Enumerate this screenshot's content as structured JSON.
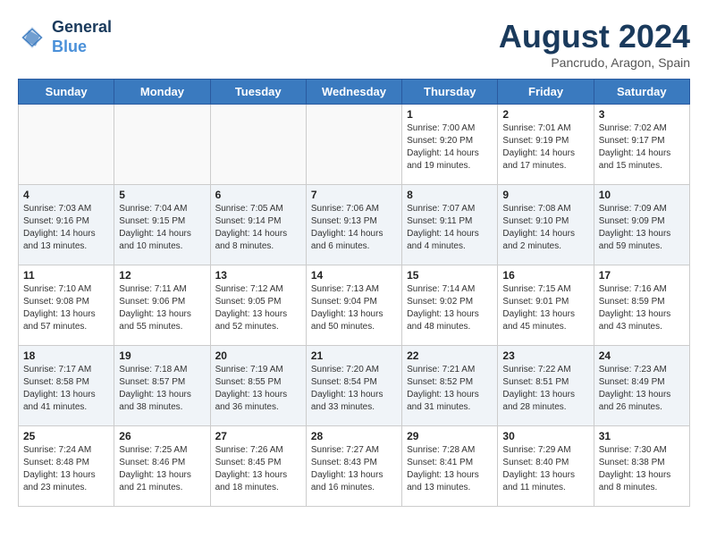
{
  "header": {
    "logo_line1": "General",
    "logo_line2": "Blue",
    "month_title": "August 2024",
    "subtitle": "Pancrudo, Aragon, Spain"
  },
  "days_of_week": [
    "Sunday",
    "Monday",
    "Tuesday",
    "Wednesday",
    "Thursday",
    "Friday",
    "Saturday"
  ],
  "weeks": [
    [
      {
        "day": "",
        "info": ""
      },
      {
        "day": "",
        "info": ""
      },
      {
        "day": "",
        "info": ""
      },
      {
        "day": "",
        "info": ""
      },
      {
        "day": "1",
        "info": "Sunrise: 7:00 AM\nSunset: 9:20 PM\nDaylight: 14 hours\nand 19 minutes."
      },
      {
        "day": "2",
        "info": "Sunrise: 7:01 AM\nSunset: 9:19 PM\nDaylight: 14 hours\nand 17 minutes."
      },
      {
        "day": "3",
        "info": "Sunrise: 7:02 AM\nSunset: 9:17 PM\nDaylight: 14 hours\nand 15 minutes."
      }
    ],
    [
      {
        "day": "4",
        "info": "Sunrise: 7:03 AM\nSunset: 9:16 PM\nDaylight: 14 hours\nand 13 minutes."
      },
      {
        "day": "5",
        "info": "Sunrise: 7:04 AM\nSunset: 9:15 PM\nDaylight: 14 hours\nand 10 minutes."
      },
      {
        "day": "6",
        "info": "Sunrise: 7:05 AM\nSunset: 9:14 PM\nDaylight: 14 hours\nand 8 minutes."
      },
      {
        "day": "7",
        "info": "Sunrise: 7:06 AM\nSunset: 9:13 PM\nDaylight: 14 hours\nand 6 minutes."
      },
      {
        "day": "8",
        "info": "Sunrise: 7:07 AM\nSunset: 9:11 PM\nDaylight: 14 hours\nand 4 minutes."
      },
      {
        "day": "9",
        "info": "Sunrise: 7:08 AM\nSunset: 9:10 PM\nDaylight: 14 hours\nand 2 minutes."
      },
      {
        "day": "10",
        "info": "Sunrise: 7:09 AM\nSunset: 9:09 PM\nDaylight: 13 hours\nand 59 minutes."
      }
    ],
    [
      {
        "day": "11",
        "info": "Sunrise: 7:10 AM\nSunset: 9:08 PM\nDaylight: 13 hours\nand 57 minutes."
      },
      {
        "day": "12",
        "info": "Sunrise: 7:11 AM\nSunset: 9:06 PM\nDaylight: 13 hours\nand 55 minutes."
      },
      {
        "day": "13",
        "info": "Sunrise: 7:12 AM\nSunset: 9:05 PM\nDaylight: 13 hours\nand 52 minutes."
      },
      {
        "day": "14",
        "info": "Sunrise: 7:13 AM\nSunset: 9:04 PM\nDaylight: 13 hours\nand 50 minutes."
      },
      {
        "day": "15",
        "info": "Sunrise: 7:14 AM\nSunset: 9:02 PM\nDaylight: 13 hours\nand 48 minutes."
      },
      {
        "day": "16",
        "info": "Sunrise: 7:15 AM\nSunset: 9:01 PM\nDaylight: 13 hours\nand 45 minutes."
      },
      {
        "day": "17",
        "info": "Sunrise: 7:16 AM\nSunset: 8:59 PM\nDaylight: 13 hours\nand 43 minutes."
      }
    ],
    [
      {
        "day": "18",
        "info": "Sunrise: 7:17 AM\nSunset: 8:58 PM\nDaylight: 13 hours\nand 41 minutes."
      },
      {
        "day": "19",
        "info": "Sunrise: 7:18 AM\nSunset: 8:57 PM\nDaylight: 13 hours\nand 38 minutes."
      },
      {
        "day": "20",
        "info": "Sunrise: 7:19 AM\nSunset: 8:55 PM\nDaylight: 13 hours\nand 36 minutes."
      },
      {
        "day": "21",
        "info": "Sunrise: 7:20 AM\nSunset: 8:54 PM\nDaylight: 13 hours\nand 33 minutes."
      },
      {
        "day": "22",
        "info": "Sunrise: 7:21 AM\nSunset: 8:52 PM\nDaylight: 13 hours\nand 31 minutes."
      },
      {
        "day": "23",
        "info": "Sunrise: 7:22 AM\nSunset: 8:51 PM\nDaylight: 13 hours\nand 28 minutes."
      },
      {
        "day": "24",
        "info": "Sunrise: 7:23 AM\nSunset: 8:49 PM\nDaylight: 13 hours\nand 26 minutes."
      }
    ],
    [
      {
        "day": "25",
        "info": "Sunrise: 7:24 AM\nSunset: 8:48 PM\nDaylight: 13 hours\nand 23 minutes."
      },
      {
        "day": "26",
        "info": "Sunrise: 7:25 AM\nSunset: 8:46 PM\nDaylight: 13 hours\nand 21 minutes."
      },
      {
        "day": "27",
        "info": "Sunrise: 7:26 AM\nSunset: 8:45 PM\nDaylight: 13 hours\nand 18 minutes."
      },
      {
        "day": "28",
        "info": "Sunrise: 7:27 AM\nSunset: 8:43 PM\nDaylight: 13 hours\nand 16 minutes."
      },
      {
        "day": "29",
        "info": "Sunrise: 7:28 AM\nSunset: 8:41 PM\nDaylight: 13 hours\nand 13 minutes."
      },
      {
        "day": "30",
        "info": "Sunrise: 7:29 AM\nSunset: 8:40 PM\nDaylight: 13 hours\nand 11 minutes."
      },
      {
        "day": "31",
        "info": "Sunrise: 7:30 AM\nSunset: 8:38 PM\nDaylight: 13 hours\nand 8 minutes."
      }
    ]
  ]
}
